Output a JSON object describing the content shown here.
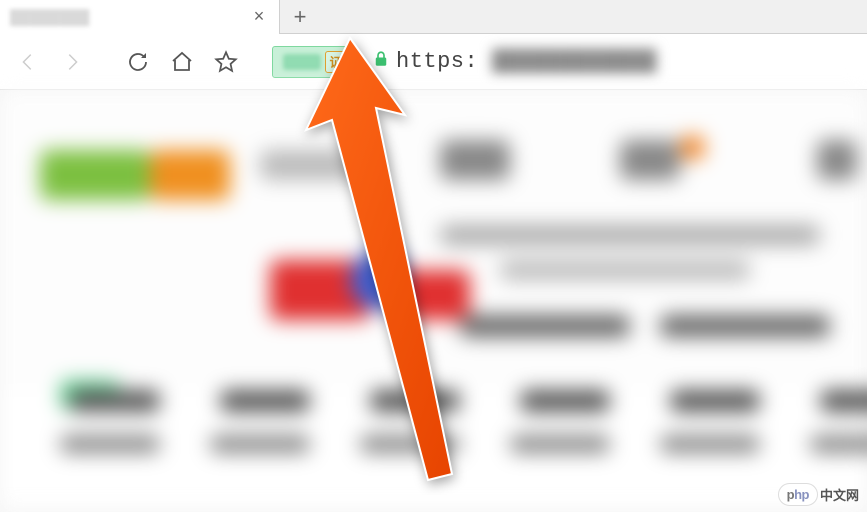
{
  "tab": {
    "close_glyph": "×",
    "new_tab_glyph": "+"
  },
  "toolbar": {
    "cert_seal_char": "证"
  },
  "address": {
    "scheme_text": "https:"
  },
  "watermark": {
    "logo_p": "p",
    "logo_hp": "hp",
    "text": "中文网"
  }
}
